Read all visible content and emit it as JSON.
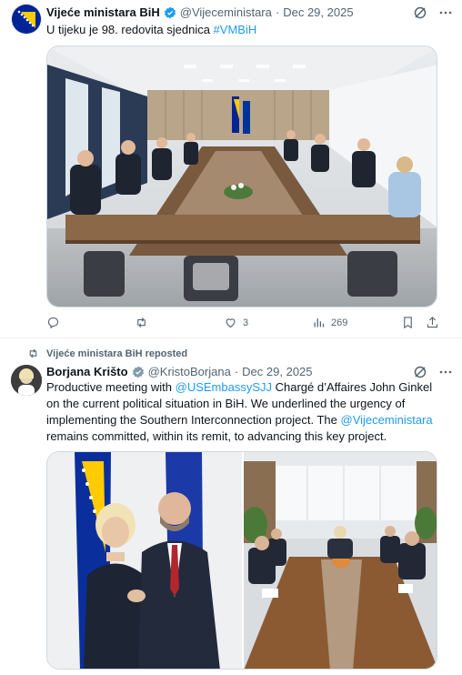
{
  "tweet1": {
    "author_name": "Vijeće ministara BiH",
    "handle": "@Vijeceministara",
    "separator": "·",
    "date": "Dec 29, 2025",
    "text": "U tijeku je 98. redovita sjednica ",
    "hashtag": "#VMBiH",
    "stats": {
      "replies": "",
      "reposts": "",
      "likes": "3",
      "views": "269"
    }
  },
  "tweet2": {
    "repost_label": "Vijeće ministara BiH reposted",
    "author_name": "Borjana Krišto",
    "handle": "@KristoBorjana",
    "separator": "·",
    "date": "Dec 29, 2025",
    "text_1": "Productive meeting with ",
    "mention_1": "@USEmbassySJJ",
    "text_2": " Chargé d’Affaires John Ginkel on the current political situation in BiH. We underlined the urgency of implementing the Southern Interconnection project. The ",
    "mention_2": "@Vijeceministara",
    "text_3": " remains committed, within its remit, to advancing this key project."
  },
  "colors": {
    "accent": "#1d9bf0",
    "muted": "#536471",
    "bih_blue": "#002395",
    "bih_yellow": "#fecb00"
  },
  "icons": [
    "grok-icon",
    "more-icon",
    "reply-icon",
    "repost-icon",
    "like-icon",
    "views-icon",
    "bookmark-icon",
    "share-icon",
    "verified-badge-icon"
  ]
}
